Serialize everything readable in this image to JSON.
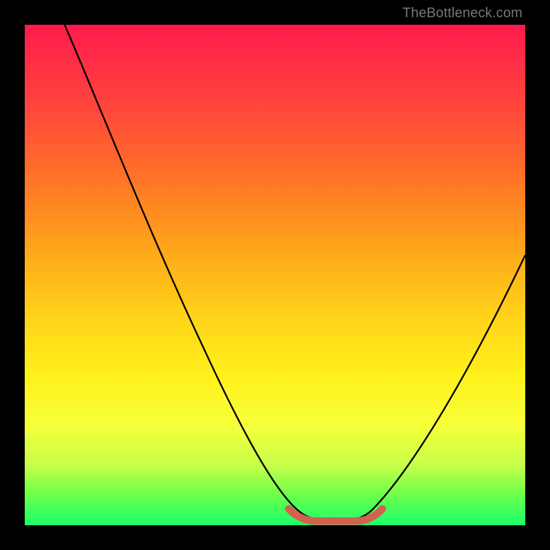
{
  "watermark": "TheBottleneck.com",
  "colors": {
    "background": "#000000",
    "gradient_top": "#ff1a4d",
    "gradient_mid": "#ffd21a",
    "gradient_bottom": "#1aff6b",
    "curve": "#000000",
    "tolerance_band": "#d3614f"
  },
  "chart_data": {
    "type": "line",
    "title": "",
    "xlabel": "",
    "ylabel": "",
    "xlim": [
      0,
      100
    ],
    "ylim": [
      0,
      100
    ],
    "grid": false,
    "series": [
      {
        "name": "bottleneck-curve",
        "x": [
          8,
          12,
          18,
          24,
          30,
          36,
          42,
          48,
          53,
          56,
          58,
          60,
          62,
          64,
          66,
          70,
          76,
          82,
          88,
          94,
          100
        ],
        "values": [
          100,
          90,
          78,
          66,
          54,
          42,
          30,
          18,
          8,
          3,
          1,
          0,
          0,
          1,
          3,
          8,
          18,
          30,
          42,
          52,
          60
        ]
      },
      {
        "name": "tolerance-band",
        "x": [
          53,
          56,
          58,
          60,
          62,
          64,
          66
        ],
        "values": [
          3,
          1.5,
          0.8,
          0.5,
          0.8,
          1.5,
          3
        ]
      }
    ],
    "annotations": []
  }
}
